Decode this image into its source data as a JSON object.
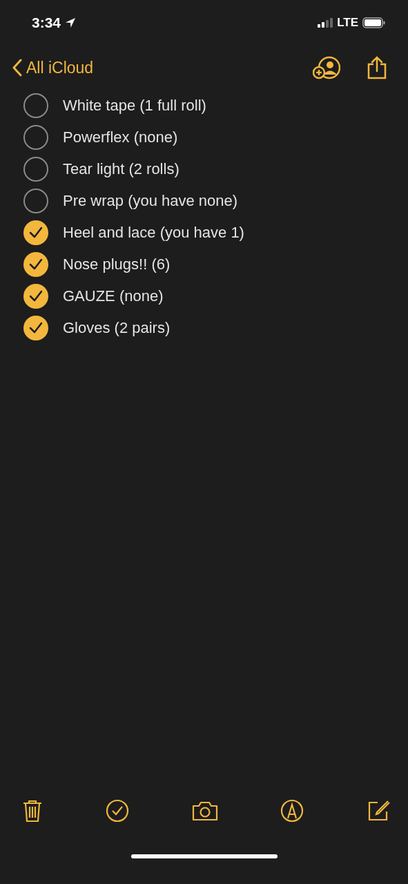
{
  "status_bar": {
    "time": "3:34",
    "network": "LTE"
  },
  "nav": {
    "back_label": "All iCloud"
  },
  "checklist": [
    {
      "text": "White tape (1 full roll)",
      "checked": false
    },
    {
      "text": "Powerflex (none)",
      "checked": false
    },
    {
      "text": "Tear light (2 rolls)",
      "checked": false
    },
    {
      "text": "Pre wrap (you have none)",
      "checked": false
    },
    {
      "text": "Heel and lace (you have 1)",
      "checked": true
    },
    {
      "text": "Nose plugs!! (6)",
      "checked": true
    },
    {
      "text": "GAUZE (none)",
      "checked": true
    },
    {
      "text": "Gloves (2 pairs)",
      "checked": true
    }
  ]
}
